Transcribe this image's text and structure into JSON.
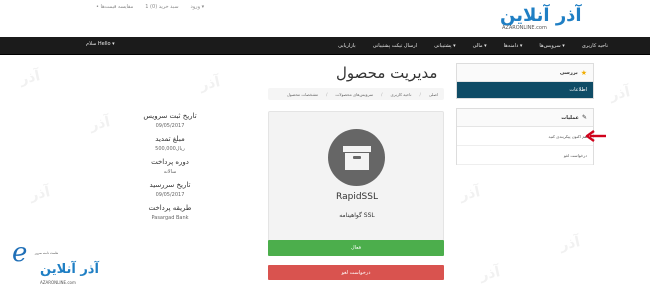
{
  "site": {
    "logo_text": "آذر آنلاین",
    "logo_sub": "AZARONLINE.com",
    "top_links": [
      "•  مقایسه قیمت‌ها",
      "1 سبد خرید (0)",
      "ورود  ▾"
    ]
  },
  "navbar": {
    "items": [
      "ناحیه کاربری",
      "سرویس‌ها ▾",
      "دامنه‌ها ▾",
      "مالی ▾",
      "پشتیبانی ▾",
      "ارسال تیکت پشتیبانی",
      "بازاریابی"
    ],
    "right": "سلام Hello ▾"
  },
  "page": {
    "title": "مدیریت محصول",
    "breadcrumb": [
      "اصلی",
      "ناحیه کاربری",
      "سرویس‌های محصولات",
      "مشخصات محصول"
    ]
  },
  "sidebar": {
    "overview_title": "بررسی",
    "overview_active": "اطلاعات",
    "actions_title": "عملیات",
    "actions": [
      "هم اکنون پیکربندی کنید",
      "درخواست لغو"
    ]
  },
  "product": {
    "name": "RapidSSL",
    "group": "گواهینامه SSL",
    "status": "فعال",
    "cancel_label": "درخواست لغو"
  },
  "info": [
    {
      "label": "تاریخ ثبت سرویس",
      "value": "09/05/2017"
    },
    {
      "label": "مبلغ تمدید",
      "value": "500,000ریال"
    },
    {
      "label": "دوره پرداخت",
      "value": "سالانه"
    },
    {
      "label": "تاریخ سررسید",
      "value": "09/05/2017"
    },
    {
      "label": "طریقه پرداخت",
      "value": "Pasargad Bank"
    }
  ],
  "corner": {
    "text": "آذر آنلاین",
    "small": "هاست دامنه سرور",
    "sub": "AZARONLINE.com"
  },
  "colors": {
    "navbar": "#1b1b1b",
    "sidebar_active": "#0f4c66",
    "status_green": "#4cae4c",
    "cancel_red": "#d9534f",
    "logo_blue": "#1f7fc4"
  }
}
